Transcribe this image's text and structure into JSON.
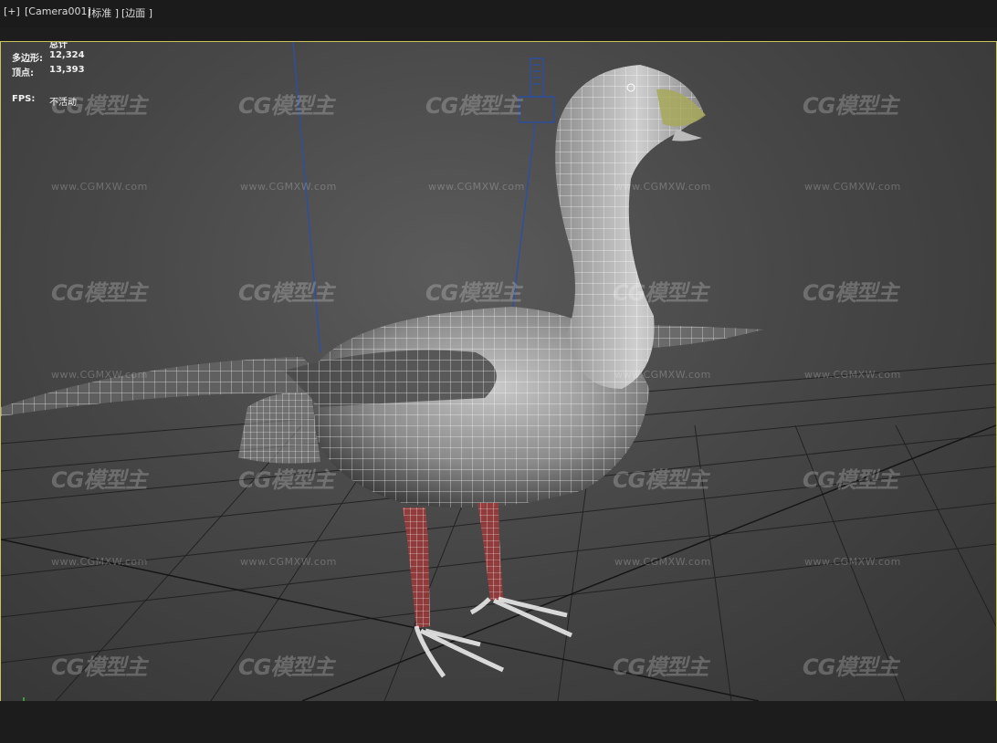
{
  "viewport_labels": {
    "plus": "[+]",
    "camera": "[Camera001]",
    "shading": "[标准 ]",
    "mode": "[边面 ]"
  },
  "stats": {
    "header": "总计",
    "polygons_label": "多边形:",
    "polygons_value": "12,324",
    "vertices_label": "顶点:",
    "vertices_value": "13,393",
    "fps_label": "FPS:",
    "fps_value": "不活动"
  },
  "watermark": {
    "logo": "CG模型主",
    "url": "www.CGMXW.com"
  },
  "colors": {
    "viewport_border": "#c8c45a",
    "camera_line": "#2a4fa8",
    "wire": "#ffffff",
    "leg_wire": "#a33a3a",
    "beak": "#a8a85a"
  },
  "icons": {
    "axis": "axis-tripod-icon",
    "camera": "camera-target-icon"
  }
}
